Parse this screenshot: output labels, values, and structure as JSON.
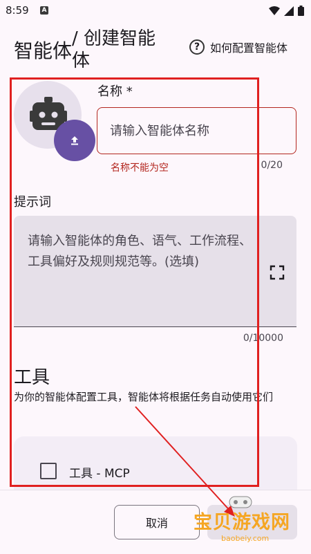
{
  "status_bar": {
    "time": "8:59",
    "notification_badge": "A"
  },
  "header": {
    "title_part1": "智能体",
    "title_part2": "/ 创建智能体",
    "help_icon": "question-circle-icon",
    "help_label": "如何配置智能体"
  },
  "avatar": {
    "icon": "robot-icon",
    "upload_icon": "upload-icon"
  },
  "name_field": {
    "label": "名称 *",
    "placeholder": "请输入智能体名称",
    "value": "",
    "error": "名称不能为空",
    "counter": "0/20"
  },
  "prompt_field": {
    "label": "提示词",
    "placeholder": "请输入智能体的角色、语气、工作流程、工具偏好及规则规范等。(选填)",
    "value": "",
    "counter": "0/10000",
    "expand_icon": "fullscreen-icon"
  },
  "tools": {
    "title": "工具",
    "description": "为你的智能体配置工具，智能体将根据任务自动使用它们",
    "items": [
      {
        "label": "工具 - MCP",
        "checked": false
      }
    ]
  },
  "actions": {
    "cancel_label": "取消",
    "create_label": ""
  },
  "watermark": {
    "text": "宝贝游戏网",
    "sub": "baobeiy.com"
  },
  "colors": {
    "primary": "#6750a4",
    "error": "#b3261e",
    "background": "#fdf7fc",
    "annotation": "#e02020",
    "watermark": "#f5a623"
  }
}
